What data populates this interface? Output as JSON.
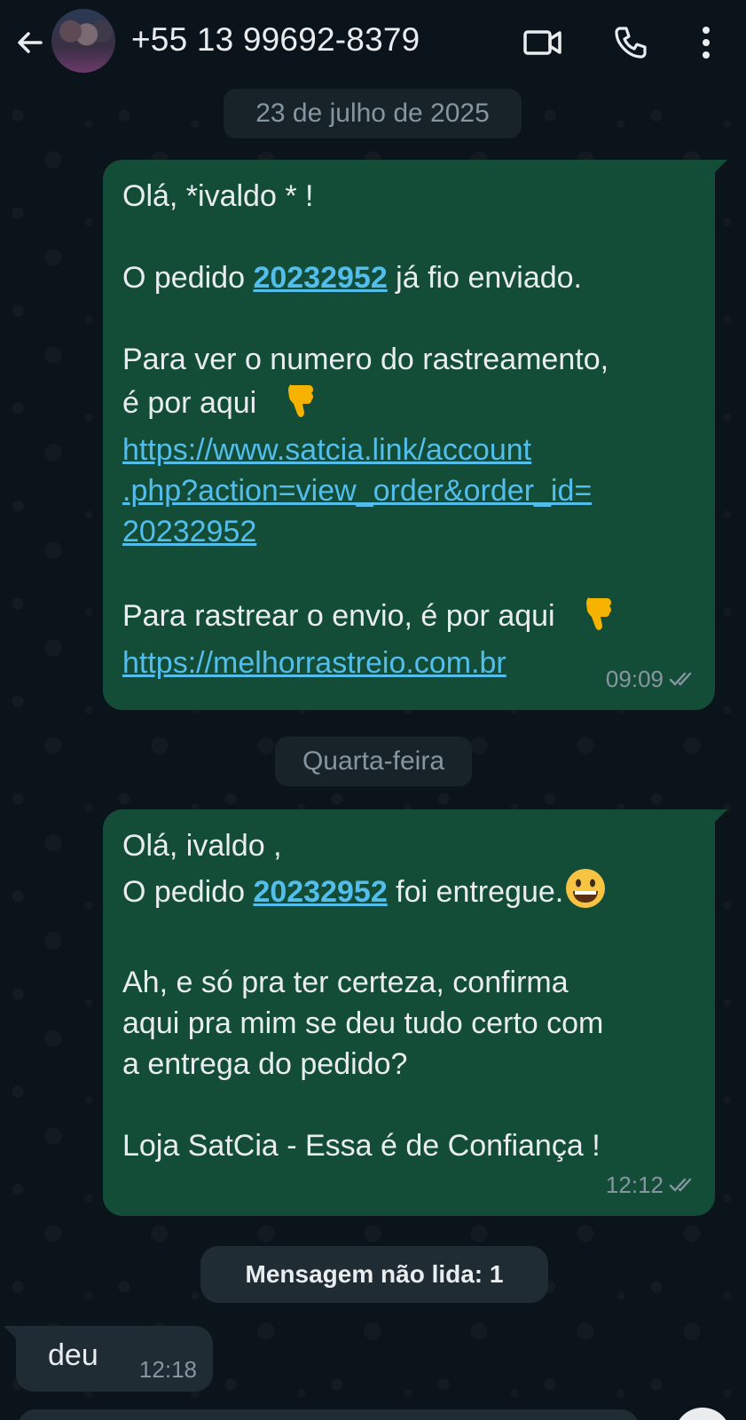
{
  "header": {
    "contact_name": "+55 13 99692-8379",
    "back_icon": "arrow-left-icon",
    "video_icon": "video-call-icon",
    "call_icon": "phone-icon",
    "menu_icon": "more-vertical-icon"
  },
  "chat": {
    "date_1": "23 de julho de 2025",
    "message_1": {
      "greeting": "Olá, *ivaldo * !",
      "order_prefix": "O pedido ",
      "order_number": "20232952",
      "order_suffix": " já fio enviado.",
      "tracking_line_1": "Para ver o numero do rastreamento,",
      "tracking_line_2": "é por aqui",
      "tracking_url_1": "https://www.satcia.link/account",
      "tracking_url_2": ".php?action=view_order&order_id=",
      "tracking_url_3": "20232952",
      "track_ship_line": "Para rastrear o envio, é por aqui",
      "track_ship_url": "https://melhorrastreio.com.br",
      "time": "09:09",
      "status": "delivered"
    },
    "date_2": "Quarta-feira",
    "message_2": {
      "greeting": "Olá, ivaldo ,",
      "order_prefix": "O pedido ",
      "order_number": "20232952",
      "order_suffix": " foi entregue.",
      "question_1": "Ah, e só pra ter certeza, confirma",
      "question_2": "aqui pra mim se deu tudo certo com",
      "question_3": "a entrega do pedido?",
      "signature": "Loja SatCia - Essa é de Confiança !",
      "time": "12:12",
      "status": "delivered"
    },
    "unread_label": "Mensagem não lida: 1",
    "incoming": {
      "text": "deu",
      "time": "12:18"
    }
  },
  "colors": {
    "background": "#0b141a",
    "outgoing_bubble": "#144d37",
    "incoming_bubble": "#1f2c34",
    "link": "#53bdeb",
    "meta_text": "#8696a0"
  }
}
